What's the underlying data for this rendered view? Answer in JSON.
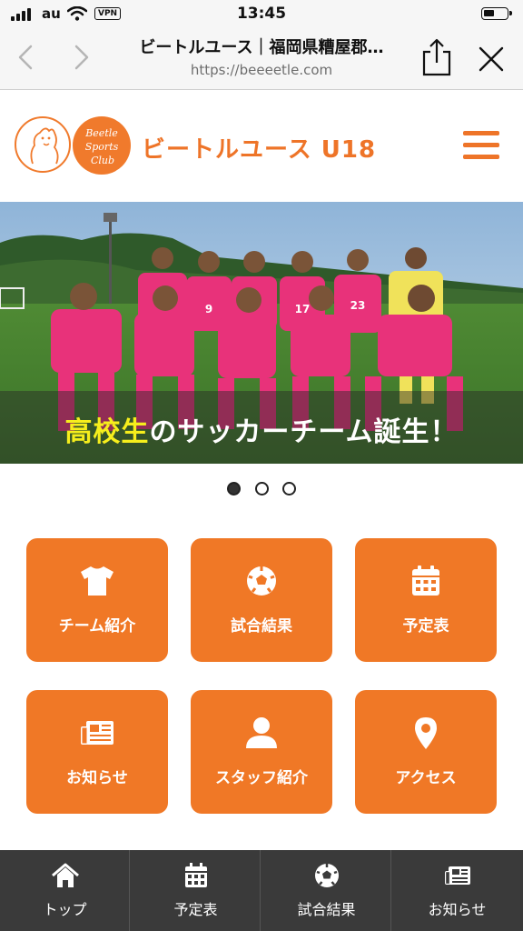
{
  "status_bar": {
    "carrier": "au",
    "vpn": "VPN",
    "time": "13:45"
  },
  "browser": {
    "title": "ビートルユース｜福岡県糟屋郡…",
    "url": "https://beeeetle.com"
  },
  "site": {
    "title": "ビートルユース U18",
    "logo_text_1": "Beetle",
    "logo_text_2": "Sports",
    "logo_text_3": "Club"
  },
  "hero": {
    "caption_highlight": "高校生",
    "caption_rest": "のサッカーチーム誕生！",
    "jersey_numbers": [
      "9",
      "17",
      "23"
    ],
    "slides_total": 3,
    "active_slide": 1
  },
  "menu": [
    {
      "label": "チーム紹介",
      "icon": "tshirt-icon"
    },
    {
      "label": "試合結果",
      "icon": "soccer-ball-icon"
    },
    {
      "label": "予定表",
      "icon": "calendar-icon"
    },
    {
      "label": "お知らせ",
      "icon": "newspaper-icon"
    },
    {
      "label": "スタッフ紹介",
      "icon": "user-icon"
    },
    {
      "label": "アクセス",
      "icon": "map-pin-icon"
    }
  ],
  "tabbar": [
    {
      "label": "トップ",
      "icon": "home-icon"
    },
    {
      "label": "予定表",
      "icon": "calendar-icon"
    },
    {
      "label": "試合結果",
      "icon": "soccer-ball-icon"
    },
    {
      "label": "お知らせ",
      "icon": "newspaper-icon"
    }
  ],
  "colors": {
    "brand": "#ee7428",
    "tile": "#f07826",
    "highlight": "#f6ee1c",
    "tabbar": "#3a3a3a"
  }
}
